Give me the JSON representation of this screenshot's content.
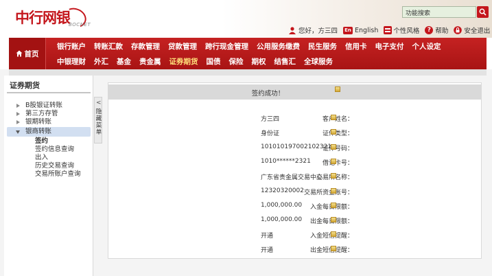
{
  "brand": {
    "logo_cn": "中行网银",
    "logo_en": "BOCNET"
  },
  "search": {
    "placeholder": "功能搜索"
  },
  "toplinks": {
    "greeting": "您好，",
    "user": "方三四",
    "english": "English",
    "english_badge": "En",
    "style": "个性风格",
    "help": "帮助",
    "logout": "安全退出"
  },
  "nav": {
    "home": "首页",
    "row1": [
      "银行账户",
      "转账汇款",
      "存款管理",
      "贷款管理",
      "跨行现金管理",
      "公用服务缴费",
      "民生服务",
      "信用卡",
      "电子支付",
      "个人设定"
    ],
    "row2": [
      "中银理财",
      "外汇",
      "基金",
      "贵金属",
      "证券期货",
      "国债",
      "保险",
      "期权",
      "结售汇",
      "全球服务"
    ],
    "active": "证券期货"
  },
  "sidebar": {
    "title": "证券期货",
    "items": [
      {
        "label": "B股银证转账"
      },
      {
        "label": "第三方存管"
      },
      {
        "label": "银期转账"
      },
      {
        "label": "银商转账"
      }
    ],
    "subitems": [
      {
        "label": "签约"
      },
      {
        "label": "签约信息查询"
      },
      {
        "label": "出入"
      },
      {
        "label": "历史交易查询"
      },
      {
        "label": "交易所账户查询"
      }
    ],
    "collapse_text": "隐藏菜单",
    "collapse_arrow": "<"
  },
  "panel": {
    "title": "签约成功！",
    "rows": [
      {
        "label": "客户姓名：",
        "value": "方三四"
      },
      {
        "label": "证件类型：",
        "value": "身份证"
      },
      {
        "label": "证件号码：",
        "value": "101010197002102321"
      },
      {
        "label": "借记卡号：",
        "value": "1010******2321"
      },
      {
        "label": "交易所名称：",
        "value": "广东省贵金属交易中心"
      },
      {
        "label": "交易所资金账号：",
        "value": "12320320002"
      },
      {
        "label": "入金每日限额：",
        "value": "1,000,000.00"
      },
      {
        "label": "出金每日限额：",
        "value": "1,000,000.00"
      },
      {
        "label": "入金短信提醒：",
        "value": "开通"
      },
      {
        "label": "出金短信提醒：",
        "value": "开通"
      }
    ]
  },
  "colors": {
    "brand_red": "#c4161c",
    "active_nav": "#ffe07a",
    "selected_item": "#d2dff1"
  }
}
